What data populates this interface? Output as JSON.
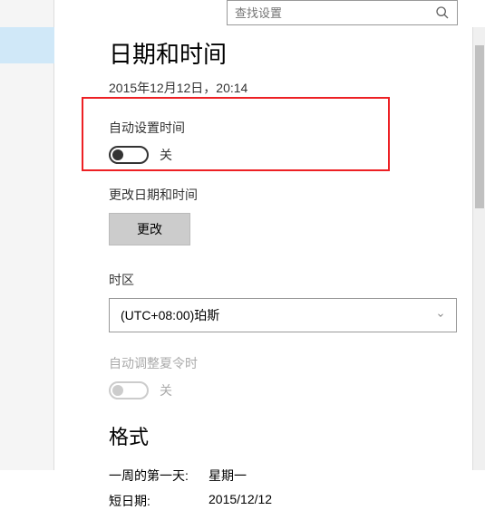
{
  "search": {
    "placeholder": "查找设置"
  },
  "page": {
    "title": "日期和时间",
    "datetime": "2015年12月12日，20:14"
  },
  "autoTime": {
    "label": "自动设置时间",
    "state": "关"
  },
  "changeTime": {
    "label": "更改日期和时间",
    "button": "更改"
  },
  "timezone": {
    "label": "时区",
    "value": "(UTC+08:00)珀斯"
  },
  "dst": {
    "label": "自动调整夏令时",
    "state": "关"
  },
  "format": {
    "title": "格式",
    "firstDayKey": "一周的第一天:",
    "firstDayVal": "星期一",
    "shortDateKey": "短日期:",
    "shortDateVal": "2015/12/12"
  }
}
